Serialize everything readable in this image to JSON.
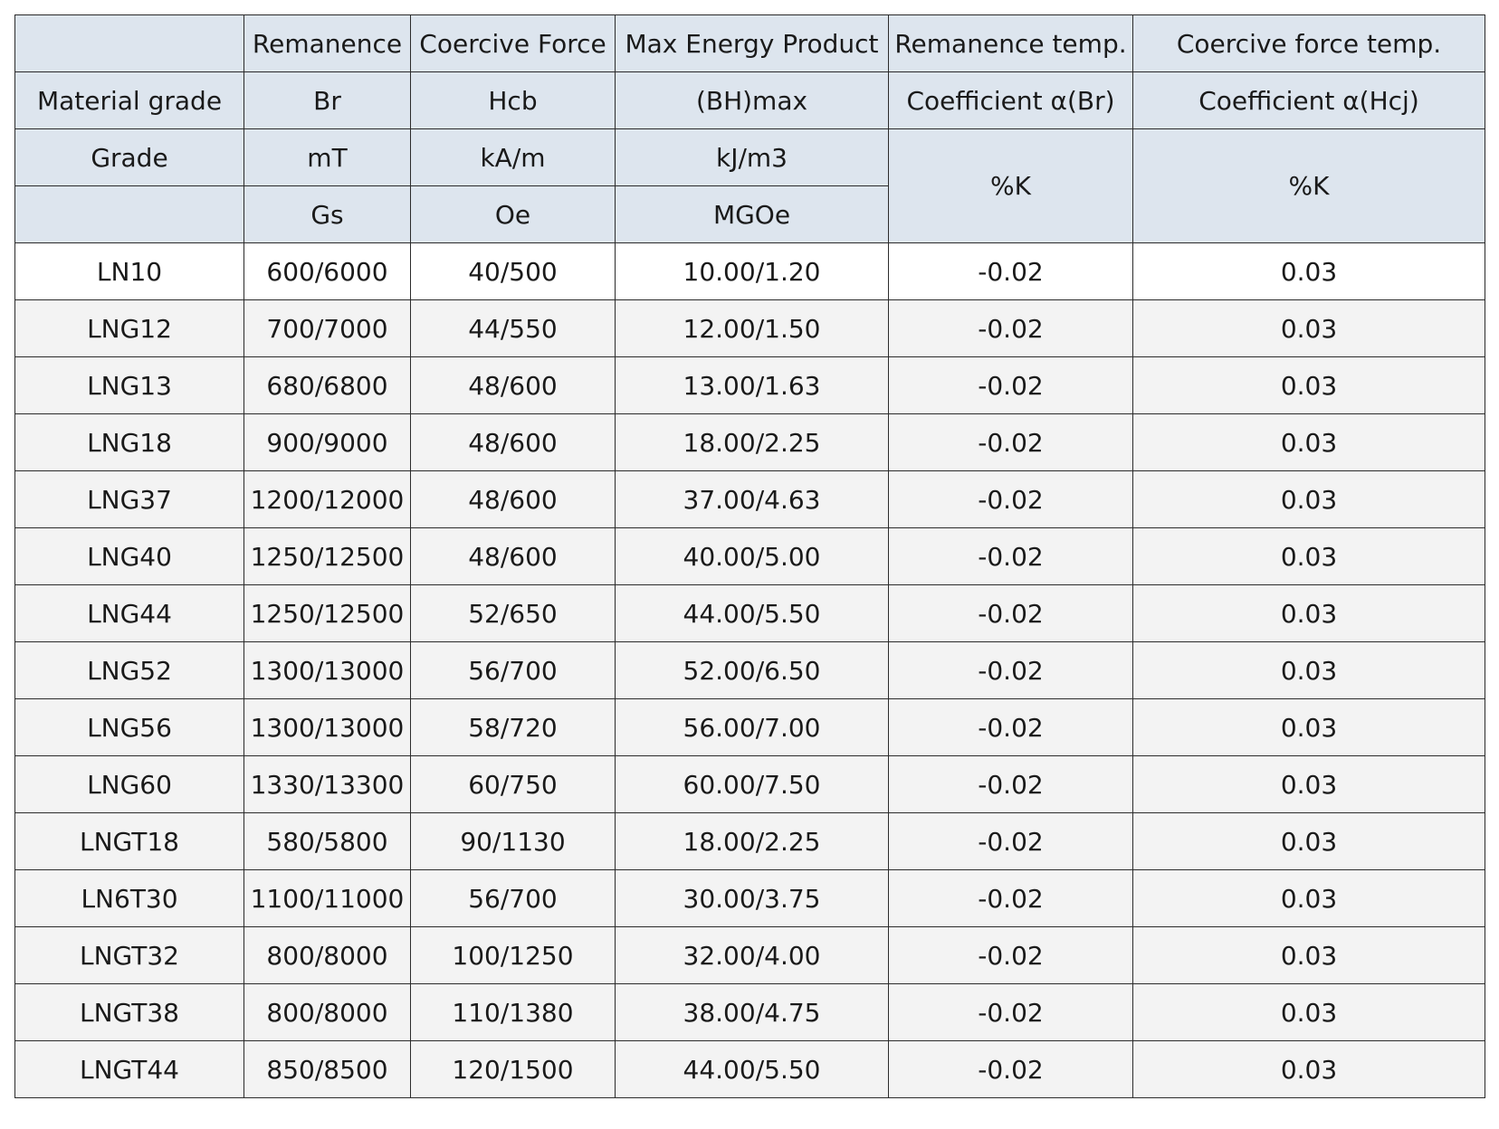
{
  "header": {
    "row1": [
      "",
      "Remanence",
      "Coercive Force",
      "Max Energy Product",
      "Remanence temp.",
      "Coercive force temp."
    ],
    "row2": [
      "Material grade",
      "Br",
      "Hcb",
      "(BH)max",
      "Coefficient α(Br)",
      "Coefficient α(Hcj)"
    ],
    "row3": [
      "Grade",
      "mT",
      "kA/m",
      "kJ/m3",
      "%K",
      "%K"
    ],
    "row4": [
      "",
      "Gs",
      "Oe",
      "MGOe"
    ]
  },
  "rows": [
    [
      "LN10",
      "600/6000",
      "40/500",
      "10.00/1.20",
      "-0.02",
      "0.03"
    ],
    [
      "LNG12",
      "700/7000",
      "44/550",
      "12.00/1.50",
      "-0.02",
      "0.03"
    ],
    [
      "LNG13",
      "680/6800",
      "48/600",
      "13.00/1.63",
      "-0.02",
      "0.03"
    ],
    [
      "LNG18",
      "900/9000",
      "48/600",
      "18.00/2.25",
      "-0.02",
      "0.03"
    ],
    [
      "LNG37",
      "1200/12000",
      "48/600",
      "37.00/4.63",
      "-0.02",
      "0.03"
    ],
    [
      "LNG40",
      "1250/12500",
      "48/600",
      "40.00/5.00",
      "-0.02",
      "0.03"
    ],
    [
      "LNG44",
      "1250/12500",
      "52/650",
      "44.00/5.50",
      "-0.02",
      "0.03"
    ],
    [
      "LNG52",
      "1300/13000",
      "56/700",
      "52.00/6.50",
      "-0.02",
      "0.03"
    ],
    [
      "LNG56",
      "1300/13000",
      "58/720",
      "56.00/7.00",
      "-0.02",
      "0.03"
    ],
    [
      "LNG60",
      "1330/13300",
      "60/750",
      "60.00/7.50",
      "-0.02",
      "0.03"
    ],
    [
      "LNGT18",
      "580/5800",
      "90/1130",
      "18.00/2.25",
      "-0.02",
      "0.03"
    ],
    [
      "LN6T30",
      "1100/11000",
      "56/700",
      "30.00/3.75",
      "-0.02",
      "0.03"
    ],
    [
      "LNGT32",
      "800/8000",
      "100/1250",
      "32.00/4.00",
      "-0.02",
      "0.03"
    ],
    [
      "LNGT38",
      "800/8000",
      "110/1380",
      "38.00/4.75",
      "-0.02",
      "0.03"
    ],
    [
      "LNGT44",
      "850/8500",
      "120/1500",
      "44.00/5.50",
      "-0.02",
      "0.03"
    ]
  ],
  "colors": {
    "header_bg": "#dde5ee",
    "row_bg": "#f3f3f3",
    "first_row_bg": "#ffffff",
    "border": "#2b2b2b"
  }
}
